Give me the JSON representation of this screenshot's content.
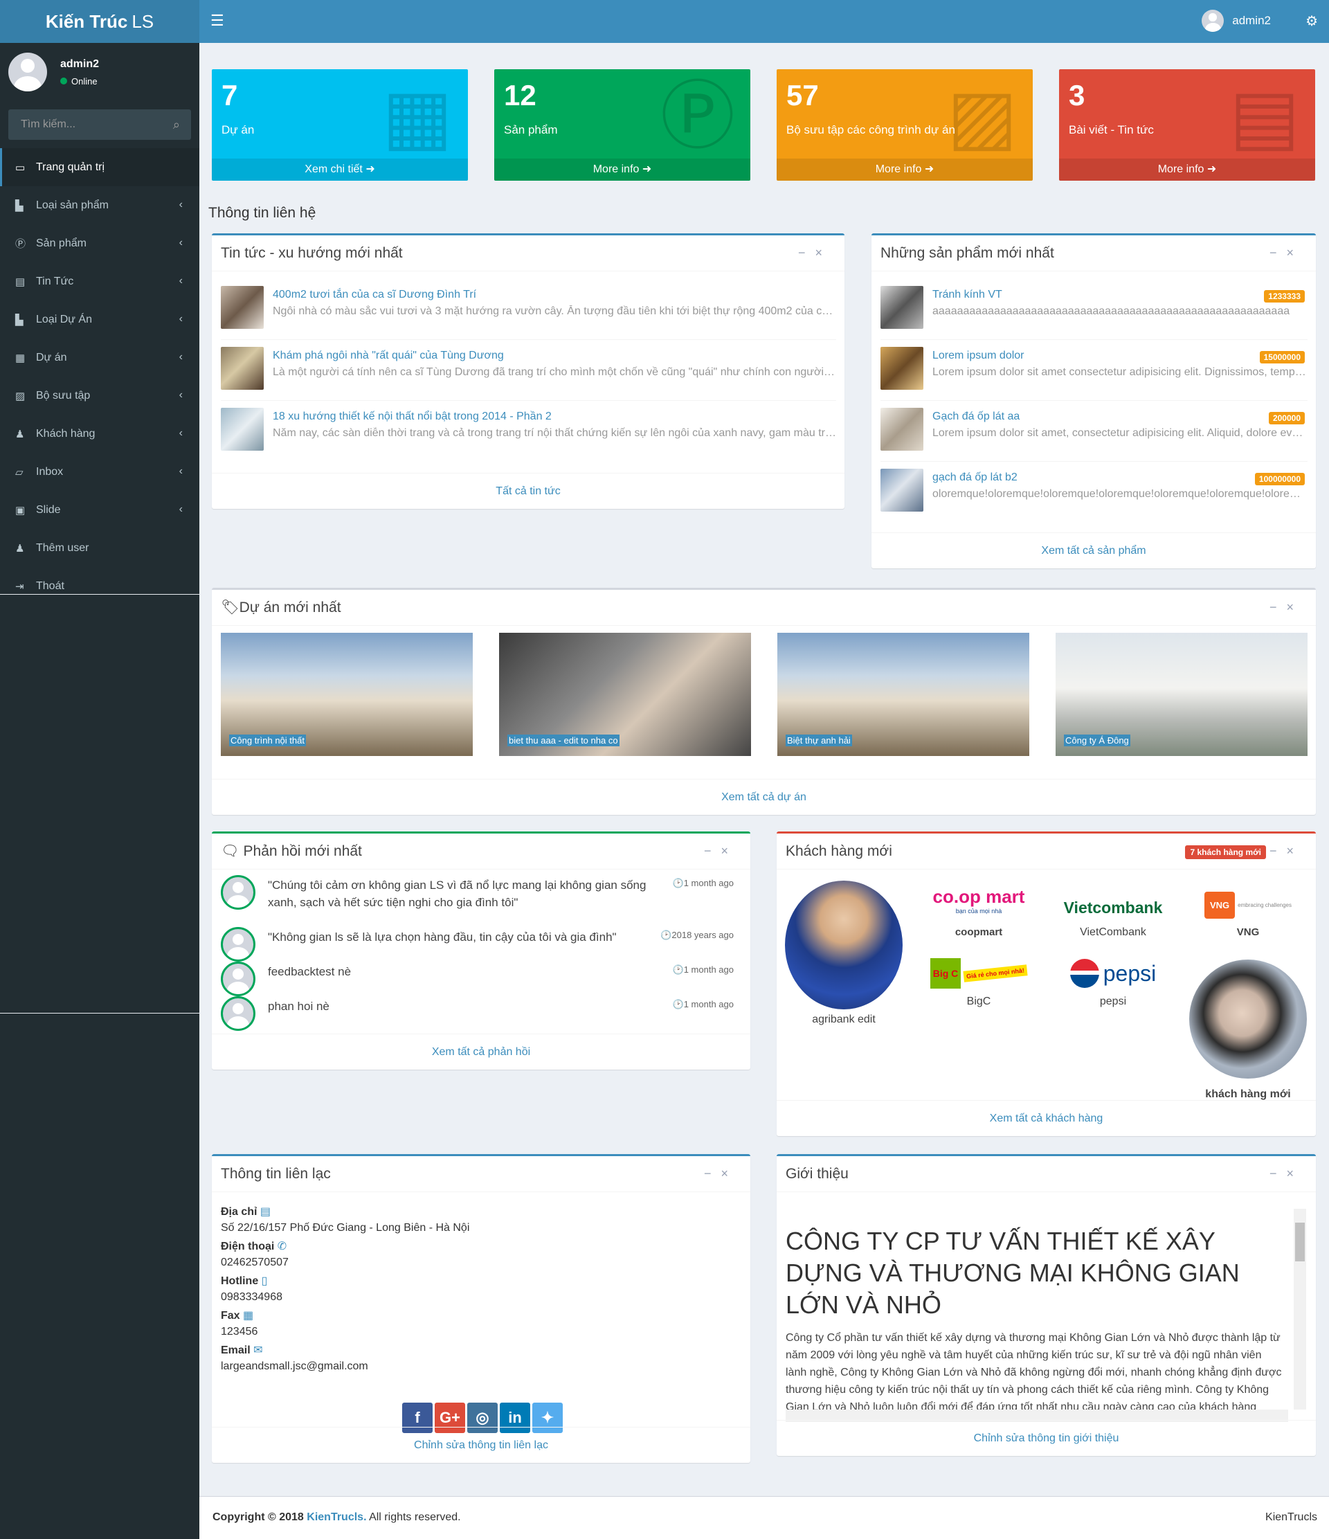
{
  "app": {
    "logo_bold": "Kiến Trúc",
    "logo_lite": "LS",
    "toggle_icon": "☰",
    "gear_icon": "⚙"
  },
  "header": {
    "user": "admin2"
  },
  "sidebar": {
    "user": "admin2",
    "status": "Online",
    "search_placeholder": "Tìm kiếm...",
    "items": [
      {
        "label": "Trang quản trị",
        "icon": "▭"
      },
      {
        "label": "Loại sản phẩm",
        "icon": "▙"
      },
      {
        "label": "Sản phẩm",
        "icon": "Ⓟ"
      },
      {
        "label": "Tin Tức",
        "icon": "▤"
      },
      {
        "label": "Loại Dự Án",
        "icon": "▙"
      },
      {
        "label": "Dự án",
        "icon": "▦"
      },
      {
        "label": "Bộ sưu tập",
        "icon": "▨"
      },
      {
        "label": "Khách hàng",
        "icon": "♟"
      },
      {
        "label": "Inbox",
        "icon": "▱"
      },
      {
        "label": "Slide",
        "icon": "▣"
      },
      {
        "label": "Thêm user",
        "icon": "♟"
      },
      {
        "label": "Thoát",
        "icon": "⇥"
      }
    ]
  },
  "stats": [
    {
      "num": "7",
      "label": "Dự án",
      "foot": "Xem chi tiết ➜",
      "color": "#00c0ef",
      "icon": "▦"
    },
    {
      "num": "12",
      "label": "Sản phẩm",
      "foot": "More info ➜",
      "color": "#00a65a",
      "icon": "Ⓟ"
    },
    {
      "num": "57",
      "label": "Bộ sưu tập các công trình dự án",
      "foot": "More info ➜",
      "color": "#f39c12",
      "icon": "▨"
    },
    {
      "num": "3",
      "label": "Bài viết - Tin tức",
      "foot": "More info ➜",
      "color": "#dd4b39",
      "icon": "▤"
    }
  ],
  "section_title": "Thông tin liên hệ",
  "news": {
    "title": "Tin tức - xu hướng mới nhất",
    "items": [
      {
        "title": "400m2 tươi tắn của ca sĩ Dương Đình Trí",
        "desc": "Ngôi nhà có màu sắc vui tươi và 3 mặt hướng ra vườn cây. Ăn tượng đầu tiên khi tới biệt thự rộng 400m2 của ca sĩ Dương Đình Trí"
      },
      {
        "title": "Khám phá ngôi nhà \"rất quái\" của Tùng Dương",
        "desc": "Là một người cá tính nên ca sĩ Tùng Dương đã trang trí cho mình một chốn về cũng \"quái\" như chính con người anh vậy."
      },
      {
        "title": "18 xu hướng thiết kế nội thất nổi bật trong 2014 - Phần 2",
        "desc": "Năm nay, các sàn diễn thời trang và cả trong trang trí nội thất chứng kiến sự lên ngôi của xanh navy, gam màu trầm"
      }
    ],
    "footer": "Tất cả tin tức"
  },
  "products": {
    "title": "Những sản phẩm mới nhất",
    "items": [
      {
        "title": "Tránh kính VT",
        "price": "1233333",
        "desc": "aaaaaaaaaaaaaaaaaaaaaaaaaaaaaaaaaaaaaaaaaaaaaaaaaaaaaaaaaa"
      },
      {
        "title": "Lorem ipsum dolor",
        "price": "15000000",
        "desc": "Lorem ipsum dolor sit amet consectetur adipisicing elit. Dignissimos, temporibus."
      },
      {
        "title": "Gạch đá ốp lát aa",
        "price": "200000",
        "desc": "Lorem ipsum dolor sit amet, consectetur adipisicing elit. Aliquid, dolore eveniet."
      },
      {
        "title": "gạch đá ốp lát b2",
        "price": "100000000",
        "desc": "oloremque!oloremque!oloremque!oloremque!oloremque!oloremque!oloremque!"
      }
    ],
    "footer": "Xem tất cả sản phẩm"
  },
  "projects": {
    "title": "Dự án mới nhất",
    "tag_icon": "🏷",
    "items": [
      {
        "caption": "Công trình nội thất"
      },
      {
        "caption": "biet thu aaa - edit to nha co"
      },
      {
        "caption": "Biệt thự anh hải"
      },
      {
        "caption": "Công ty Á Đông"
      }
    ],
    "footer": "Xem tất cả dự án"
  },
  "feedback": {
    "title": "Phản hồi mới nhất",
    "icon": "🗨",
    "items": [
      {
        "text": "\"Chúng tôi cảm ơn không gian LS vì đã nổ lực mang lại không gian sống xanh, sạch và hết sức tiện nghi cho gia đình tôi\"",
        "time": "🕑1 month ago"
      },
      {
        "text": "\"Không gian ls sẽ là lựa chọn hàng đầu, tin cậy của tôi và gia đình\"",
        "time": "🕑2018 years ago"
      },
      {
        "text": "feedbacktest nè",
        "time": "🕑1 month ago"
      },
      {
        "text": "phan hoi nè",
        "time": "🕑1 month ago"
      }
    ],
    "footer": "Xem tất cả phản hồi"
  },
  "customers": {
    "title": "Khách hàng mới",
    "badge": "7 khách hàng mới",
    "items": [
      {
        "name": "agribank edit"
      },
      {
        "name": "coopmart",
        "logo": "co.op mart",
        "tagline": "bạn của mọi nhà"
      },
      {
        "name": "VietCombank",
        "logo": "Vietcombank"
      },
      {
        "name": "VNG",
        "logo": "VNG",
        "tagline": "embracing challenges"
      },
      {
        "name": "BigC",
        "logo": "Big C",
        "tagline": "Giá rẻ cho mọi nhà!"
      },
      {
        "name": "pepsi",
        "logo": "pepsi"
      },
      {
        "name": "khách hàng mới"
      }
    ],
    "footer": "Xem tất cả khách hàng"
  },
  "contact": {
    "title": "Thông tin liên lạc",
    "address_label": "Địa chỉ",
    "address": "Số 22/16/157 Phố Đức Giang - Long Biên - Hà Nội",
    "phone_label": "Điện thoại",
    "phone": "02462570507",
    "hotline_label": "Hotline",
    "hotline": "0983334968",
    "fax_label": "Fax",
    "fax": "123456",
    "email_label": "Email",
    "email": "largeandsmall.jsc@gmail.com",
    "social": [
      "f",
      "G+",
      "◎",
      "in",
      "✦"
    ],
    "footer": "Chỉnh sửa thông tin liên lạc"
  },
  "about": {
    "title": "Giới thiệu",
    "heading": "CÔNG TY CP TƯ VẤN THIẾT KẾ XÂY DỰNG VÀ THƯƠNG MẠI KHÔNG GIAN LỚN VÀ NHỎ",
    "body": "Công ty Cổ phần tư vấn thiết kế xây dựng và thương mại Không Gian Lớn và Nhỏ được thành lập từ năm 2009 với lòng yêu nghề và tâm huyết của những kiến trúc sư, kĩ sư trẻ và đội ngũ nhân viên lành nghề, Công ty Không Gian Lớn và Nhỏ đã không ngừng đổi mới, nhanh chóng khẳng định được thương hiệu công ty kiến trúc nội thất uy tín và phong cách thiết kế của riêng mình. Công ty Không Gian Lớn và Nhỏ luôn luôn đổi mới để đáp ứng tốt nhất nhu cầu ngày càng cao của khách hàng trong môi trường cạnh tranh ngày nay.",
    "footer": "Chỉnh sửa thông tin giới thiệu"
  },
  "footer": {
    "prefix": "Copyright © 2018 ",
    "brand": "KienTrucls.",
    "suffix": " All rights reserved.",
    "right": "KienTrucls"
  }
}
